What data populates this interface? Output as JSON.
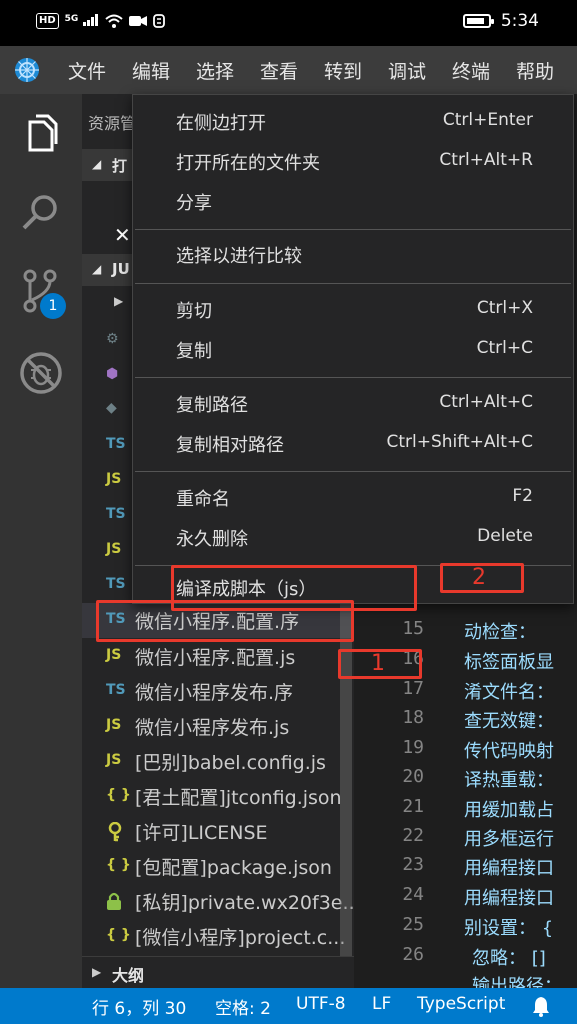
{
  "phone_status": {
    "hd": "HD",
    "signal": "5G",
    "time": "5:34",
    "battery_level": 0.85
  },
  "menubar": {
    "items": [
      "文件",
      "编辑",
      "选择",
      "查看",
      "转到",
      "调试",
      "终端",
      "帮助"
    ]
  },
  "activity": {
    "scm_badge": "1"
  },
  "sidebar": {
    "title": "资源管",
    "open_editors_label": "打",
    "workspace_label": "JU",
    "outline_label": "大纲",
    "files": [
      {
        "icon": "TS",
        "name": "微信小程序.配置.序"
      },
      {
        "icon": "JS",
        "name": "微信小程序.配置.js"
      },
      {
        "icon": "TS",
        "name": "微信小程序发布.序"
      },
      {
        "icon": "JS",
        "name": "微信小程序发布.js"
      },
      {
        "icon": "JS",
        "name": "[巴别]babel.config.js"
      },
      {
        "icon": "{ }",
        "name": "[君土配置]jtconfig.json"
      },
      {
        "icon": "key",
        "name": "[许可]LICENSE"
      },
      {
        "icon": "{ }",
        "name": "[包配置]package.json"
      },
      {
        "icon": "lock",
        "name": "[私钥]private.wx20f3e..."
      },
      {
        "icon": "{ }",
        "name": "[微信小程序]project.c..."
      }
    ],
    "hidden_rows": [
      "TS",
      "JS",
      "TS",
      "JS",
      "TS"
    ]
  },
  "editor": {
    "line_numbers": [
      "15",
      "16",
      "17",
      "18",
      "19",
      "20",
      "21",
      "22",
      "23",
      "24",
      "25",
      "26"
    ],
    "lines": [
      "动检查：",
      "标签面板显",
      "淆文件名：",
      "查无效键：",
      "传代码映射",
      "译热重载：",
      "用缓加载占",
      "用多框运行",
      "用编程接口",
      "用编程接口",
      "别设置： {",
      "忽略： []",
      "输出路径："
    ]
  },
  "context_menu": {
    "items": [
      {
        "label": "在侧边打开",
        "key": "Ctrl+Enter"
      },
      {
        "label": "打开所在的文件夹",
        "key": "Ctrl+Alt+R"
      },
      {
        "label": "分享",
        "key": ""
      },
      {
        "label": "选择以进行比较",
        "key": ""
      },
      {
        "label": "剪切",
        "key": "Ctrl+X"
      },
      {
        "label": "复制",
        "key": "Ctrl+C"
      },
      {
        "label": "复制路径",
        "key": "Ctrl+Alt+C"
      },
      {
        "label": "复制相对路径",
        "key": "Ctrl+Shift+Alt+C"
      },
      {
        "label": "重命名",
        "key": "F2"
      },
      {
        "label": "永久删除",
        "key": "Delete"
      },
      {
        "label": "编译成脚本（js）",
        "key": ""
      }
    ]
  },
  "annotations": {
    "label_1": "1",
    "label_2": "2",
    "color": "#e8392c"
  },
  "statusbar": {
    "position": "行 6，列 30",
    "spaces": "空格: 2",
    "encoding": "UTF-8",
    "eol": "LF",
    "language": "TypeScript"
  },
  "colors": {
    "accent": "#007acc",
    "menubar": "#3c3c3c",
    "sidebar": "#252526",
    "editor": "#1e1e1e"
  }
}
